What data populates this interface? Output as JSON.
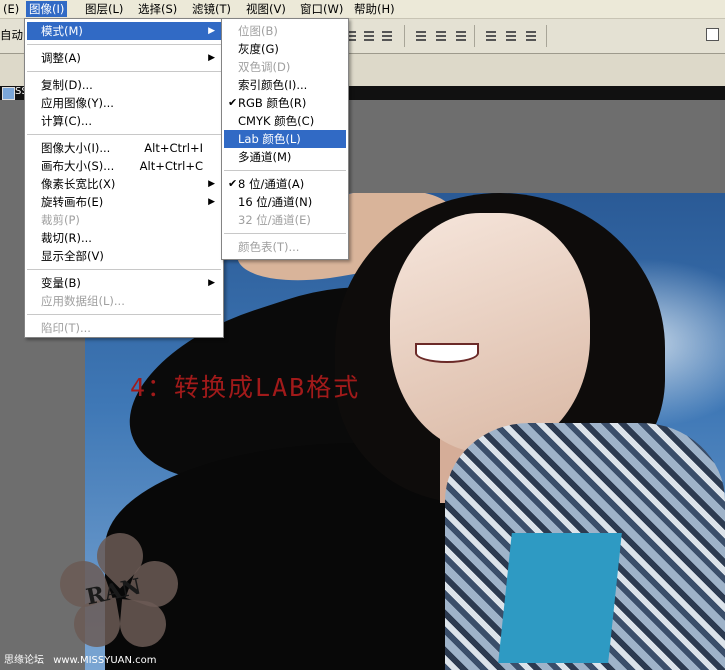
{
  "menubar": {
    "items": [
      "(E)",
      "图像(I)",
      "图层(L)",
      "选择(S)",
      "滤镜(T)",
      "视图(V)",
      "窗口(W)",
      "帮助(H)"
    ]
  },
  "optionsbar": {
    "auto_label": "自动"
  },
  "document": {
    "tab_title": "SS"
  },
  "image_menu": {
    "items": [
      {
        "label": "模式(M)",
        "submenu": true,
        "highlighted": true
      },
      {
        "label": "调整(A)",
        "submenu": true
      },
      {
        "label": "复制(D)..."
      },
      {
        "label": "应用图像(Y)..."
      },
      {
        "label": "计算(C)..."
      },
      {
        "label": "图像大小(I)...",
        "shortcut": "Alt+Ctrl+I"
      },
      {
        "label": "画布大小(S)...",
        "shortcut": "Alt+Ctrl+C"
      },
      {
        "label": "像素长宽比(X)",
        "submenu": true
      },
      {
        "label": "旋转画布(E)",
        "submenu": true
      },
      {
        "label": "裁剪(P)",
        "disabled": true
      },
      {
        "label": "裁切(R)..."
      },
      {
        "label": "显示全部(V)"
      },
      {
        "label": "变量(B)",
        "submenu": true
      },
      {
        "label": "应用数据组(L)...",
        "disabled": true
      },
      {
        "label": "陷印(T)...",
        "disabled": true
      }
    ]
  },
  "mode_submenu": {
    "items": [
      {
        "label": "位图(B)",
        "disabled": true
      },
      {
        "label": "灰度(G)"
      },
      {
        "label": "双色调(D)",
        "disabled": true
      },
      {
        "label": "索引颜色(I)..."
      },
      {
        "label": "RGB 颜色(R)",
        "checked": true
      },
      {
        "label": "CMYK 颜色(C)"
      },
      {
        "label": "Lab 颜色(L)",
        "highlighted": true
      },
      {
        "label": "多通道(M)"
      },
      {
        "label": "8 位/通道(A)",
        "checked": true
      },
      {
        "label": "16 位/通道(N)"
      },
      {
        "label": "32 位/通道(E)",
        "disabled": true
      },
      {
        "label": "颜色表(T)...",
        "disabled": true
      }
    ]
  },
  "annotation": {
    "text": "4：转换成LAB格式",
    "color": "#a11a1a"
  },
  "watermark": {
    "text": "RAN"
  },
  "footer": {
    "site_name": "思缘论坛",
    "url": "www.MISSYUAN.com"
  },
  "colors": {
    "menu_highlight": "#316ac5",
    "disabled_text": "#a0a0a0"
  },
  "icons": [
    "check-icon",
    "submenu-arrow-icon",
    "document-icon",
    "align-icon"
  ]
}
